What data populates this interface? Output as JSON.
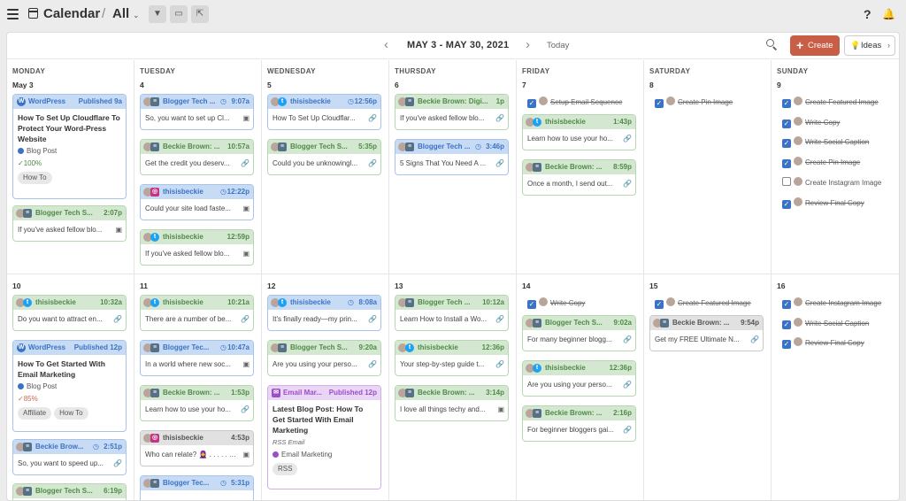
{
  "header": {
    "title": "Calendar",
    "separator": "/",
    "view": "All",
    "view_chevron": "⌄",
    "help": "?",
    "filter_icon": "▼",
    "screen_icon": "▭",
    "share_icon": "⇱",
    "bell_icon": "🔔"
  },
  "nav": {
    "prev": "‹",
    "range": "MAY 3 - MAY 30, 2021",
    "next": "›",
    "today": "Today",
    "create": "Create",
    "create_plus": "+",
    "ideas": "Ideas",
    "ideas_bulb": "💡",
    "ideas_chev": "›"
  },
  "days": [
    "MONDAY",
    "TUESDAY",
    "WEDNESDAY",
    "THURSDAY",
    "FRIDAY",
    "SATURDAY",
    "SUNDAY"
  ],
  "week1_nums": [
    "May 3",
    "4",
    "5",
    "6",
    "7",
    "8",
    "9"
  ],
  "week2_nums": [
    "10",
    "11",
    "12",
    "13",
    "14",
    "15",
    "16"
  ],
  "icons": {
    "link": "🔗",
    "image": "▣",
    "clock": "◷",
    "check": "✓",
    "twitter": "t",
    "instagram": "◎",
    "buffer": "≡",
    "wordpress": "W",
    "email": "✉"
  },
  "mon1": {
    "wp": {
      "network": "WordPress",
      "status": "Published 9a",
      "title": "How To Set Up Cloudflare To Protect Your Word-Press Website",
      "category": "Blog Post",
      "pct": "✓100%",
      "tag": "How To"
    },
    "c2": {
      "name": "Blogger Tech S...",
      "time": "2:07p",
      "text": "If you've asked fellow blo..."
    }
  },
  "tue1": [
    {
      "name": "Blogger Tech ...",
      "time": "9:07a",
      "text": "So, you want to set up Cl..."
    },
    {
      "name": "Beckie Brown: ...",
      "time": "10:57a",
      "text": "Get the credit you deserv..."
    },
    {
      "name": "thisisbeckie",
      "time": "12:22p",
      "text": "Could your site load faste..."
    },
    {
      "name": "thisisbeckie",
      "time": "12:59p",
      "text": "If you've asked fellow blo..."
    }
  ],
  "wed1": [
    {
      "name": "thisisbeckie",
      "time": "12:56p",
      "text": "How To Set Up Cloudflar..."
    },
    {
      "name": "Blogger Tech S...",
      "time": "5:35p",
      "text": "Could you be unknowingl..."
    }
  ],
  "thu1": [
    {
      "name": "Beckie Brown: Digi...",
      "time": "1p",
      "text": "If you've asked fellow blo..."
    },
    {
      "name": "Blogger Tech ...",
      "time": "3:46p",
      "text": "5 Signs That You Need A ..."
    }
  ],
  "fri1": {
    "task": "Setup Email Sequence",
    "cards": [
      {
        "name": "thisisbeckie",
        "time": "1:43p",
        "text": "Learn how to use your ho..."
      },
      {
        "name": "Beckie Brown: ...",
        "time": "8:59p",
        "text": "Once a month, I send out..."
      }
    ]
  },
  "sat1": {
    "task": "Create Pin Image"
  },
  "sun1": [
    "Create Featured Image",
    "Write Copy",
    "Write Social Caption",
    "Create Pin Image",
    "Create Instagram Image",
    "Review Final Copy"
  ],
  "mon2": {
    "c1": {
      "name": "thisisbeckie",
      "time": "10:32a",
      "text": "Do you want to attract en..."
    },
    "wp": {
      "network": "WordPress",
      "status": "Published 12p",
      "title": "How To Get Started With Email Marketing",
      "category": "Blog Post",
      "pct": "✓85%",
      "tags": [
        "Affiliate",
        "How To"
      ]
    },
    "c3": {
      "name": "Beckie Brow...",
      "time": "2:51p",
      "text": "So, you want to speed up..."
    },
    "c4": {
      "name": "Blogger Tech S...",
      "time": "6:19p"
    }
  },
  "tue2": [
    {
      "name": "thisisbeckie",
      "time": "10:21a",
      "text": "There are a number of be..."
    },
    {
      "name": "Blogger Tec...",
      "time": "10:47a",
      "text": "In a world where new soc..."
    },
    {
      "name": "Beckie Brown: ...",
      "time": "1:53p",
      "text": "Learn how to use your ho..."
    },
    {
      "name": "thisisbeckie",
      "time": "4:53p",
      "text": "Who can relate? 🧕 . . . . . . . ."
    },
    {
      "name": "Blogger Tec...",
      "time": "5:31p"
    }
  ],
  "wed2": {
    "cards": [
      {
        "name": "thisisbeckie",
        "time": "8:08a",
        "text": "It's finally ready—my prin..."
      },
      {
        "name": "Blogger Tech S...",
        "time": "9:20a",
        "text": "Are you using your perso..."
      }
    ],
    "email": {
      "network": "Email Mar...",
      "status": "Published 12p",
      "title": "Latest Blog Post: How To Get Started With Email Marketing",
      "sub": "RSS Email",
      "category": "Email Marketing",
      "tag": "RSS"
    }
  },
  "thu2": [
    {
      "name": "Blogger Tech ...",
      "time": "10:12a",
      "text": "Learn How to Install a Wo..."
    },
    {
      "name": "thisisbeckie",
      "time": "12:36p",
      "text": "Your step-by-step guide t..."
    },
    {
      "name": "Beckie Brown: ...",
      "time": "3:14p",
      "text": "I love all things techy and..."
    }
  ],
  "fri2": {
    "task": "Write Copy",
    "cards": [
      {
        "name": "Blogger Tech S...",
        "time": "9:02a",
        "text": "For many beginner blogg..."
      },
      {
        "name": "thisisbeckie",
        "time": "12:36p",
        "text": "Are you using your perso..."
      },
      {
        "name": "Beckie Brown: ...",
        "time": "2:16p",
        "text": "For beginner bloggers gai..."
      }
    ]
  },
  "sat2": {
    "task": "Create Featured Image",
    "card": {
      "name": "Beckie Brown: ...",
      "time": "9:54p",
      "text": "Get my FREE Ultimate N..."
    }
  },
  "sun2": [
    "Create Instagram Image",
    "Write Social Caption",
    "Review Final Copy"
  ]
}
